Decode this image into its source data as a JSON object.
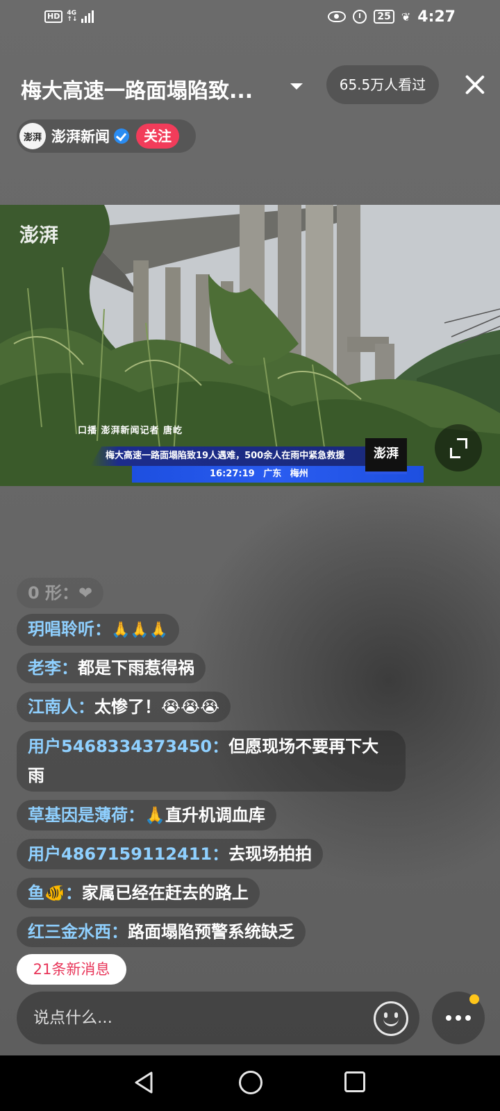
{
  "status_bar": {
    "hd": "HD",
    "network_top": "4G",
    "network_bottom": "↑↓",
    "battery": "25",
    "time": "4:27"
  },
  "header": {
    "title": "梅大高速一路面塌陷致...",
    "viewers": "65.5万人看过"
  },
  "channel": {
    "avatar_text": "澎湃",
    "name": "澎湃新闻",
    "follow_label": "关注"
  },
  "video": {
    "logo_text": "澎湃",
    "reporter_line": "口播  澎湃新闻记者  唐屹",
    "headline": "梅大高速一路面塌陷致19人遇难，500余人在雨中紧急救援",
    "subline": "16:27:19    广东  梅州",
    "logo_box_text": "澎湃"
  },
  "chat": {
    "messages": [
      {
        "name": "玥唱聆听：",
        "text": "🙏🙏🙏"
      },
      {
        "name": "老李：",
        "text": "都是下雨惹得祸"
      },
      {
        "name": "江南人：",
        "text": "太惨了！😭😭😭"
      },
      {
        "name": "用户5468334373450：",
        "text": "但愿现场不要再下大雨"
      },
      {
        "name": "草基因是薄荷：",
        "text": "🙏直升机调血库"
      },
      {
        "name": "用户4867159112411：",
        "text": "去现场拍拍"
      },
      {
        "name": "鱼🐠：",
        "text": "家属已经在赶去的路上"
      },
      {
        "name": "红三金水西：",
        "text": "路面塌陷预警系统缺乏"
      }
    ],
    "faded_top": "0 形：❤",
    "new_messages": "21条新消息"
  },
  "input": {
    "placeholder": "说点什么..."
  },
  "colors": {
    "follow": "#f23c5a",
    "username": "#8fd0ff",
    "new_msg_text": "#e8365a",
    "notification_dot": "#ffc61a"
  }
}
